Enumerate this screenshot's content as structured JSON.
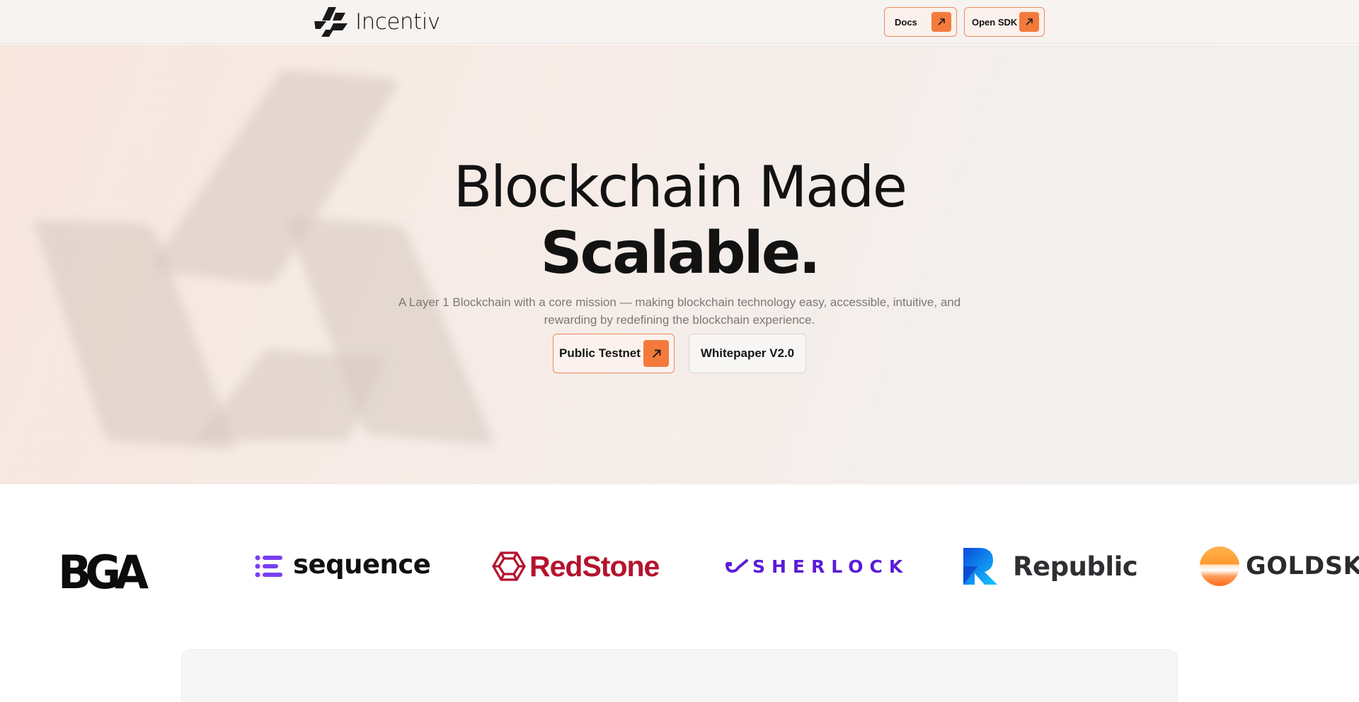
{
  "brand": {
    "name": "Incentiv",
    "icon": "incentiv-logo-icon"
  },
  "nav": {
    "docs_label": "Docs",
    "sdk_label": "Open SDK",
    "arrow_icon": "arrow-up-right-icon"
  },
  "hero": {
    "title_line1": "Blockchain Made",
    "title_line2": "Scalable.",
    "subtitle": "A Layer 1 Blockchain with a core mission — making blockchain technology easy, accessible, intuitive, and rewarding by redefining the blockchain experience.",
    "primary_cta": "Public Testnet",
    "secondary_cta": "Whitepaper V2.0"
  },
  "partners": [
    {
      "name": "BGA",
      "icon": "bga-logo"
    },
    {
      "name": "sequence",
      "icon": "sequence-logo"
    },
    {
      "name": "RedStone",
      "icon": "redstone-logo"
    },
    {
      "name": "SHERLOCK",
      "icon": "sherlock-logo"
    },
    {
      "name": "Republic",
      "icon": "republic-logo"
    },
    {
      "name": "GOLDSKY",
      "icon": "goldsky-logo"
    }
  ],
  "colors": {
    "accent": "#f47a3c",
    "accent_border": "#ec8a5c",
    "header_bg": "#f6f3f1",
    "redstone": "#b4132e",
    "sherlock": "#5b1bd6"
  }
}
